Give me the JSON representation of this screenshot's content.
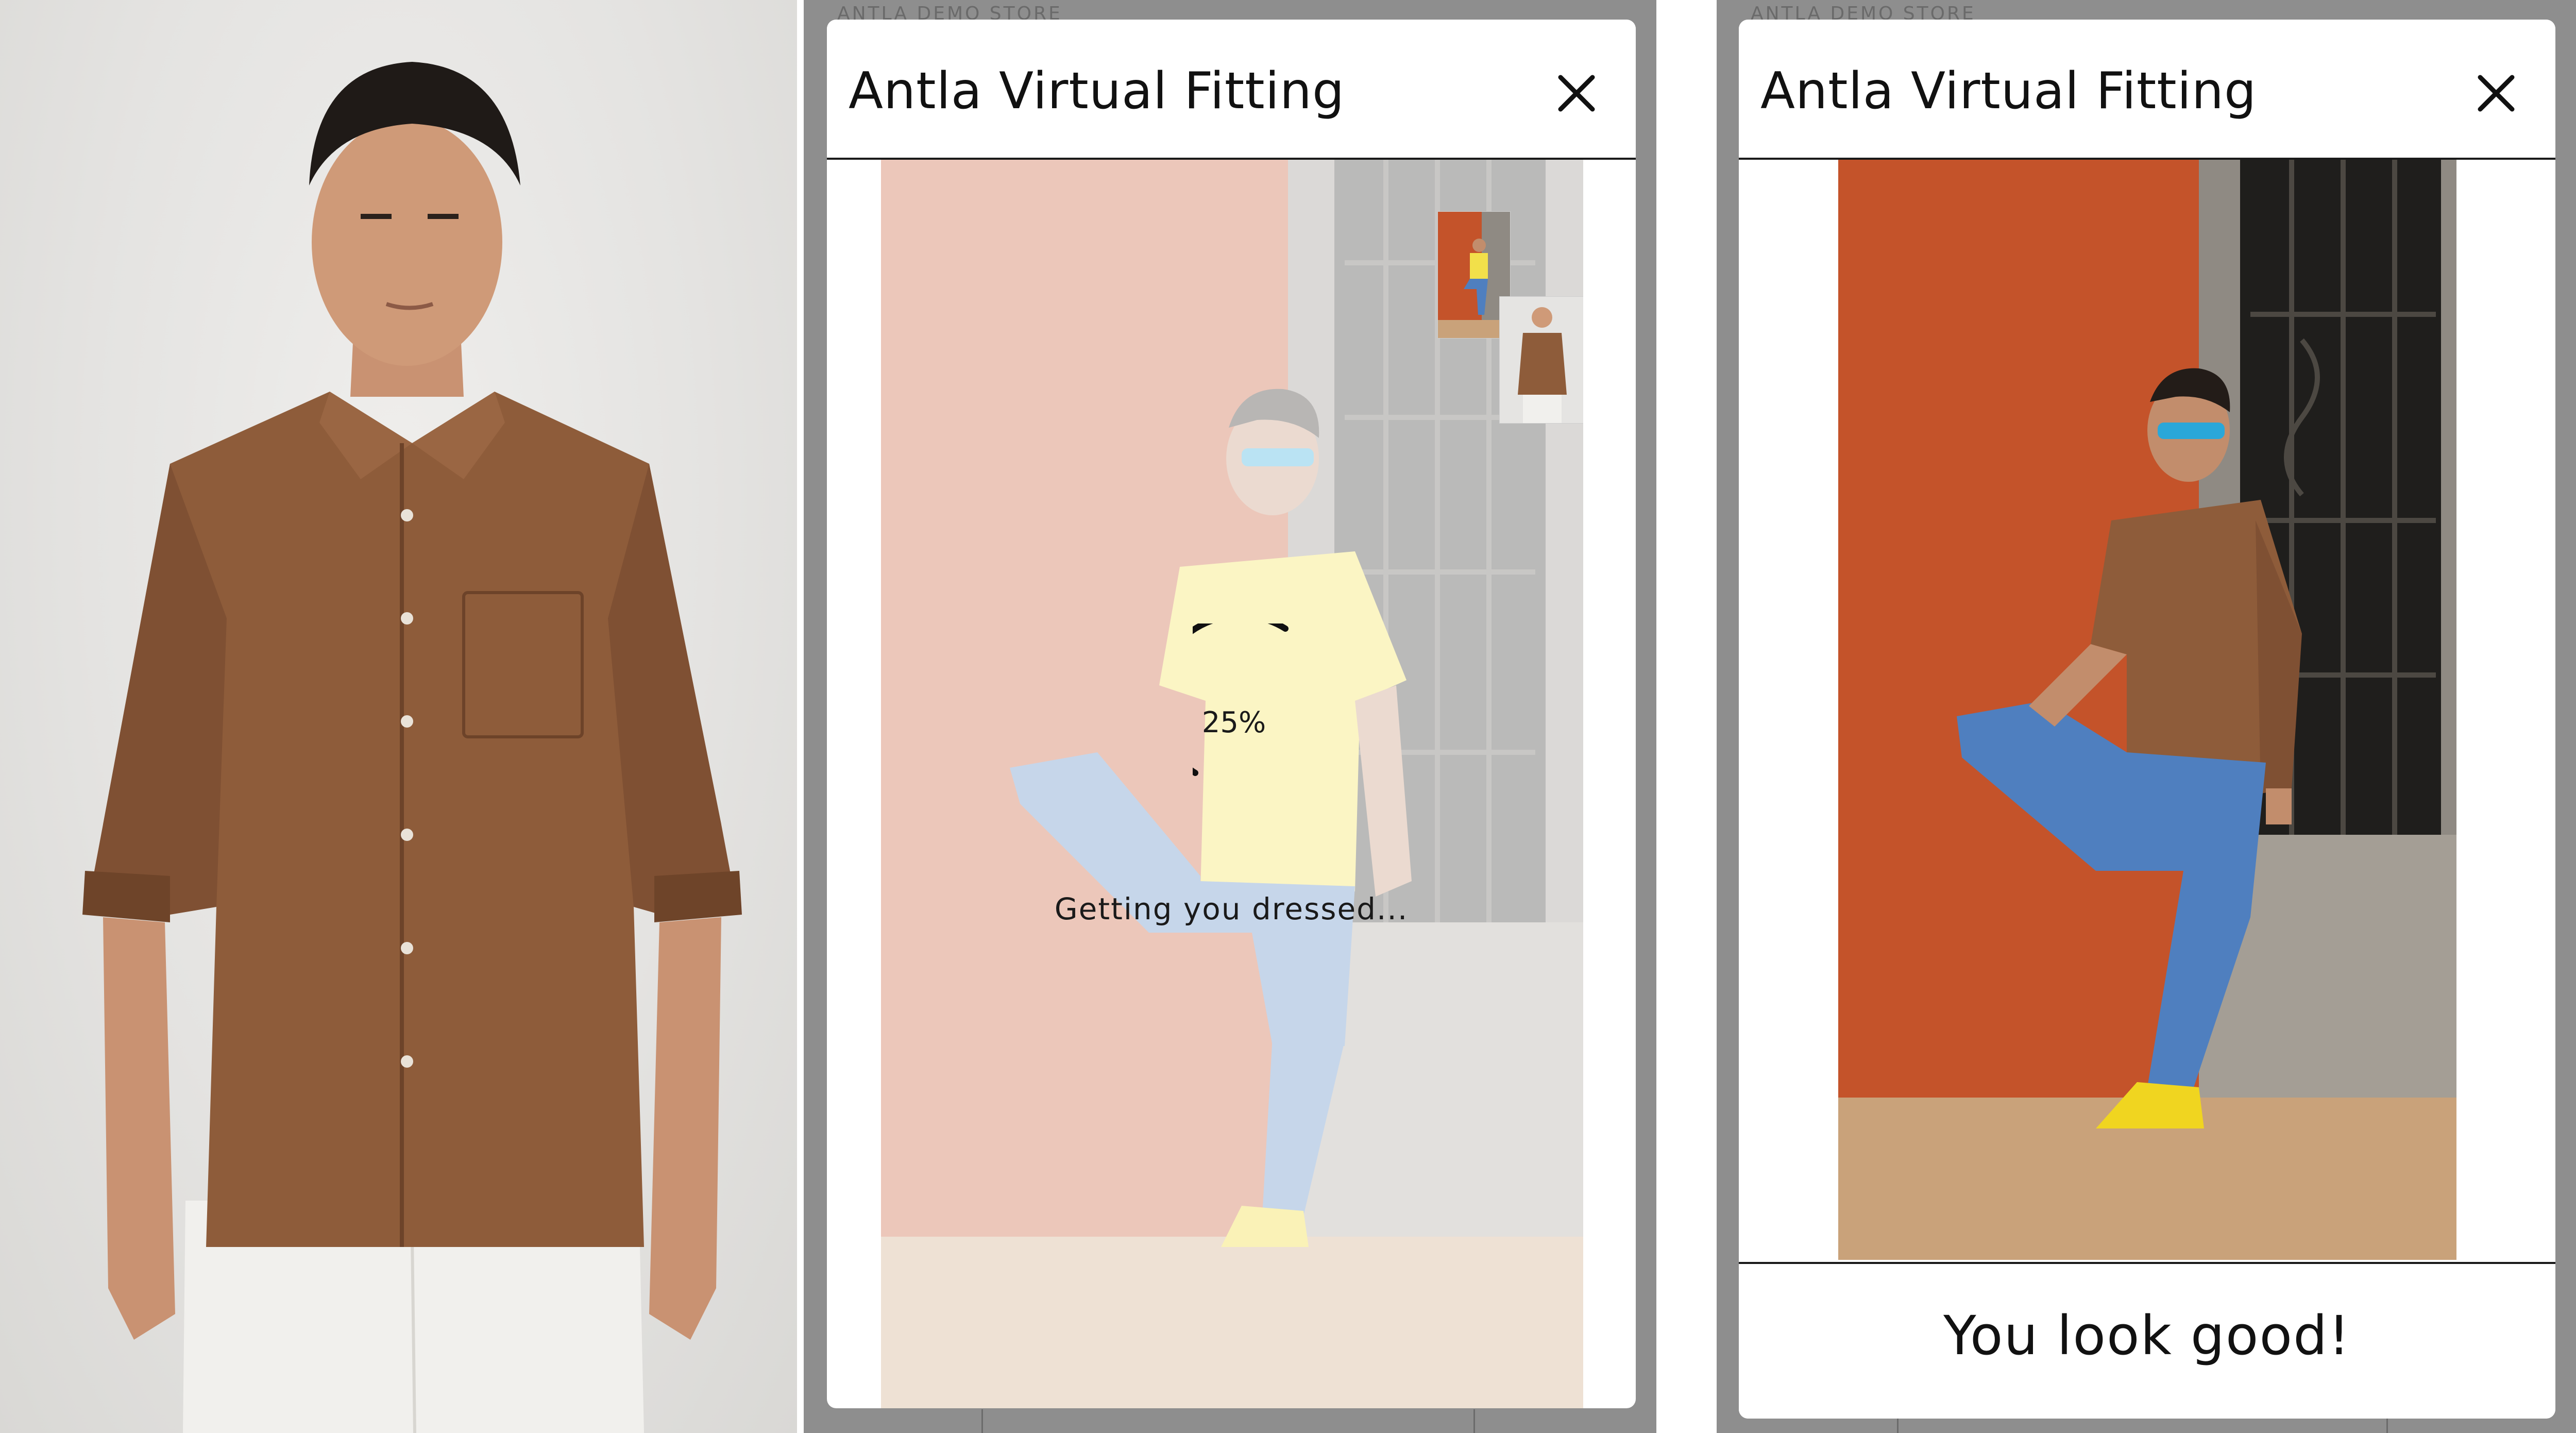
{
  "store": {
    "name": "ANTLA DEMO STORE"
  },
  "modal": {
    "title": "Antla Virtual Fitting"
  },
  "loading": {
    "progress_label": "25%",
    "progress": 0.25,
    "status": "Getting you dressed..."
  },
  "result": {
    "message": "You look good!"
  },
  "icons": {
    "close": "close-icon",
    "spinner": "loading-spinner-icon"
  },
  "colors": {
    "shirt": "#8e5c3a",
    "wall": "#c4532a",
    "jeans": "#4f7fbf",
    "tee": "#f2e04a",
    "sneaker": "#f0d520"
  }
}
